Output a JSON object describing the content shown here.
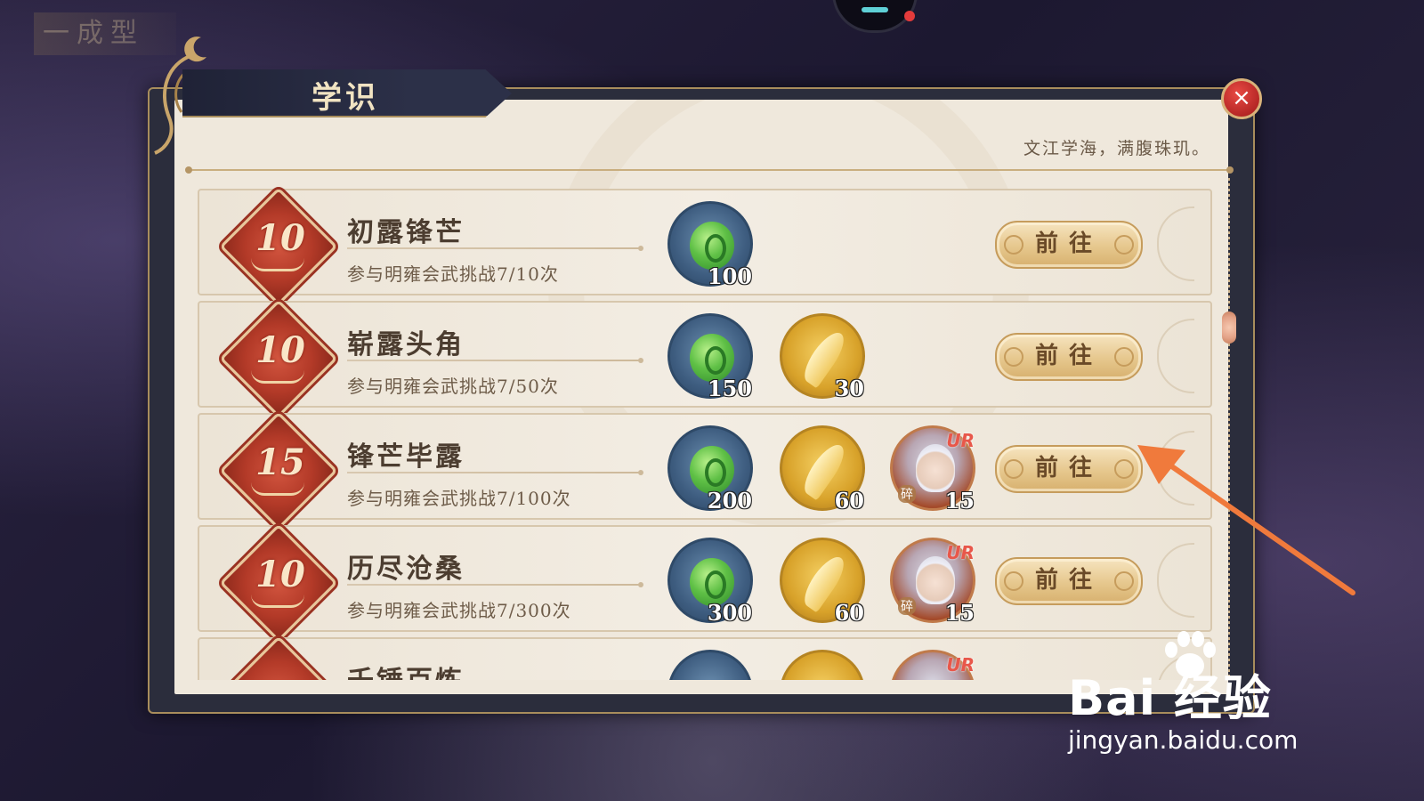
{
  "background": {
    "title_text": "一成型"
  },
  "panel": {
    "title": "学识",
    "motto": "文江学海，满腹珠玑。",
    "close_label": "×"
  },
  "tasks": [
    {
      "medal": "10",
      "name": "初露锋芒",
      "desc": "参与明雍会武挑战7/10次",
      "rewards": [
        {
          "type": "jade",
          "qty": "100"
        }
      ],
      "button": "前往"
    },
    {
      "medal": "10",
      "name": "崭露头角",
      "desc": "参与明雍会武挑战7/50次",
      "rewards": [
        {
          "type": "jade",
          "qty": "150"
        },
        {
          "type": "feather",
          "qty": "30"
        }
      ],
      "button": "前往"
    },
    {
      "medal": "15",
      "name": "锋芒毕露",
      "desc": "参与明雍会武挑战7/100次",
      "rewards": [
        {
          "type": "jade",
          "qty": "200"
        },
        {
          "type": "feather",
          "qty": "60"
        },
        {
          "type": "character-fragment",
          "qty": "15",
          "rarity": "UR",
          "tag": "碎"
        }
      ],
      "button": "前往"
    },
    {
      "medal": "10",
      "name": "历尽沧桑",
      "desc": "参与明雍会武挑战7/300次",
      "rewards": [
        {
          "type": "jade",
          "qty": "300"
        },
        {
          "type": "feather",
          "qty": "60"
        },
        {
          "type": "character-fragment",
          "qty": "15",
          "rarity": "UR",
          "tag": "碎"
        }
      ],
      "button": "前往"
    },
    {
      "medal": "",
      "name": "千锤百炼",
      "desc": "",
      "rewards": [
        {
          "type": "jade",
          "qty": ""
        },
        {
          "type": "feather",
          "qty": ""
        },
        {
          "type": "character-fragment",
          "qty": "",
          "rarity": "UR",
          "tag": ""
        }
      ],
      "button": ""
    }
  ],
  "watermark": {
    "brand": "Bai  经验",
    "url": "jingyan.baidu.com"
  },
  "colors": {
    "accent_arrow": "#f07a3c",
    "close_red": "#c62a24",
    "gold": "#d7b06e"
  }
}
